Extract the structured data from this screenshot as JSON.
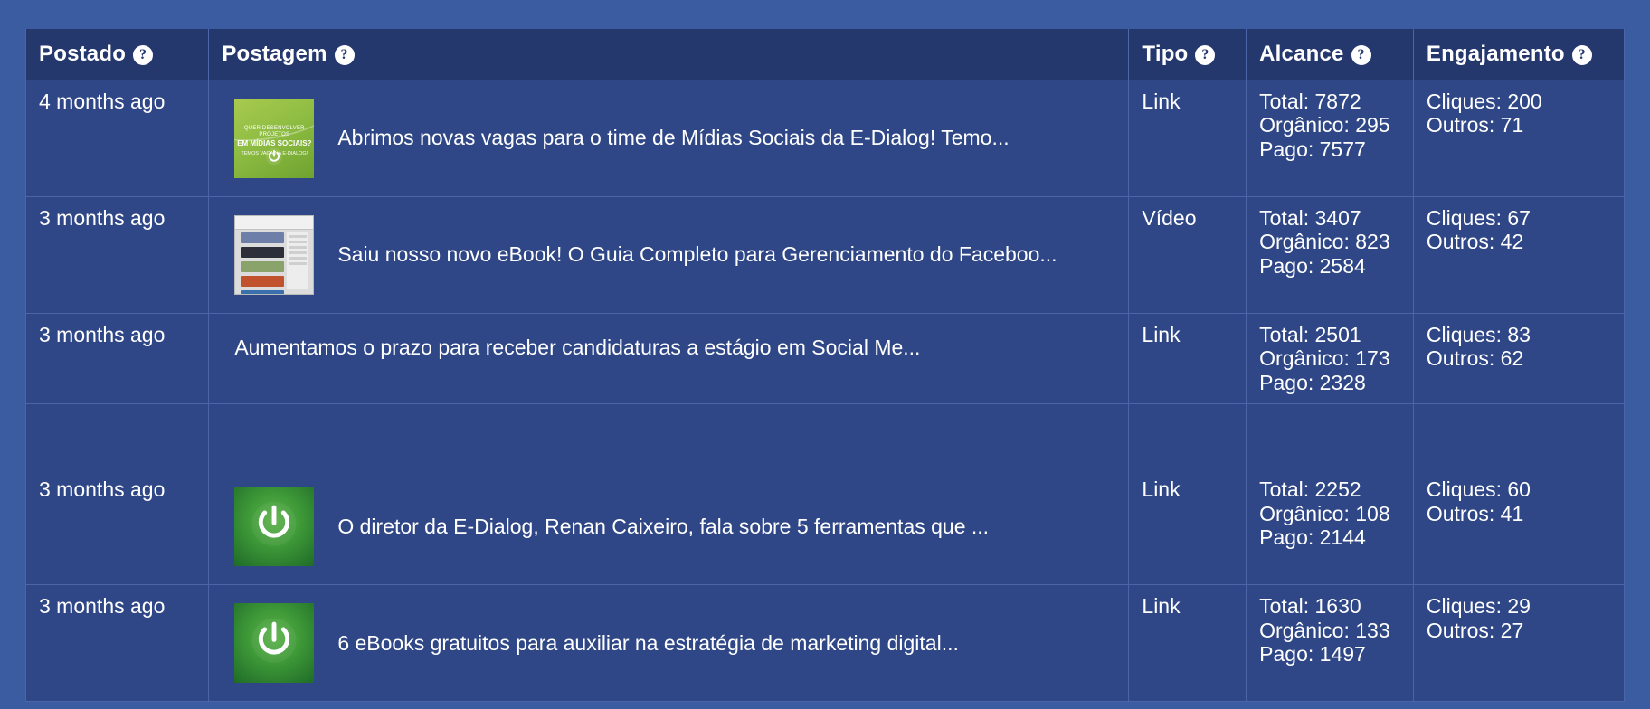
{
  "table": {
    "columns": [
      {
        "key": "posted",
        "label": "Postado",
        "help": "?",
        "help_icon": "help-circle-icon"
      },
      {
        "key": "post",
        "label": "Postagem",
        "help": "?",
        "help_icon": "help-circle-icon"
      },
      {
        "key": "type",
        "label": "Tipo",
        "help": "?",
        "help_icon": "help-circle-icon"
      },
      {
        "key": "reach",
        "label": "Alcance",
        "help": "?",
        "help_icon": "help-circle-icon"
      },
      {
        "key": "engage",
        "label": "Engajamento",
        "help": "?",
        "help_icon": "help-circle-icon"
      }
    ],
    "rows": [
      {
        "posted": "4 months ago",
        "thumbnail": {
          "kind": "ebook-cover",
          "line1": "QUER DESENVOLVER PROJETOS",
          "line2": "EM MÍDIAS SOCIAIS?",
          "line3": "TEMOS VAGA NA E-DIALOG!",
          "icon": "power-icon"
        },
        "text": "Abrimos novas vagas para o time de Mídias Sociais da E-Dialog! Temo...",
        "type": "Link",
        "reach": {
          "total": "Total: 7872",
          "organic": "Orgânico: 295",
          "paid": "Pago: 7577"
        },
        "engagement": {
          "clicks": "Cliques: 200",
          "others": "Outros: 71"
        }
      },
      {
        "posted": "3 months ago",
        "thumbnail": {
          "kind": "screenshot",
          "icon": "screenshot-thumbnail"
        },
        "text": "Saiu nosso novo eBook! O Guia Completo para Gerenciamento do Faceboo...",
        "type": "Vídeo",
        "reach": {
          "total": "Total: 3407",
          "organic": "Orgânico: 823",
          "paid": "Pago: 2584"
        },
        "engagement": {
          "clicks": "Cliques: 67",
          "others": "Outros: 42"
        }
      },
      {
        "posted": "3 months ago",
        "thumbnail": {
          "kind": "none"
        },
        "text": "Aumentamos o prazo para receber candidaturas a estágio em Social Me...",
        "type": "Link",
        "reach": {
          "total": "Total: 2501",
          "organic": "Orgânico: 173",
          "paid": "Pago: 2328"
        },
        "engagement": {
          "clicks": "Cliques: 83",
          "others": "Outros: 62"
        }
      },
      {
        "posted": "",
        "thumbnail": {
          "kind": "none"
        },
        "text": "",
        "type": "",
        "reach": {
          "total": "",
          "organic": "",
          "paid": ""
        },
        "engagement": {
          "clicks": "",
          "others": ""
        }
      },
      {
        "posted": "3 months ago",
        "thumbnail": {
          "kind": "logo-power",
          "icon": "power-icon"
        },
        "text": "O diretor da E-Dialog, Renan Caixeiro, fala sobre 5 ferramentas que ...",
        "type": "Link",
        "reach": {
          "total": "Total: 2252",
          "organic": "Orgânico: 108",
          "paid": "Pago: 2144"
        },
        "engagement": {
          "clicks": "Cliques: 60",
          "others": "Outros: 41"
        }
      },
      {
        "posted": "3 months ago",
        "thumbnail": {
          "kind": "logo-power",
          "icon": "power-icon"
        },
        "text": "6 eBooks gratuitos para auxiliar na estratégia de marketing digital...",
        "type": "Link",
        "reach": {
          "total": "Total: 1630",
          "organic": "Orgânico: 133",
          "paid": "Pago: 1497"
        },
        "engagement": {
          "clicks": "Cliques: 29",
          "others": "Outros: 27"
        }
      }
    ]
  },
  "colors": {
    "page_background": "#3b5ca0",
    "header_background": "#24386e",
    "cell_background": "#2f4786",
    "grid_line": "#4a66a8",
    "text": "#ffffff",
    "logo_green": "#3f9a38"
  }
}
